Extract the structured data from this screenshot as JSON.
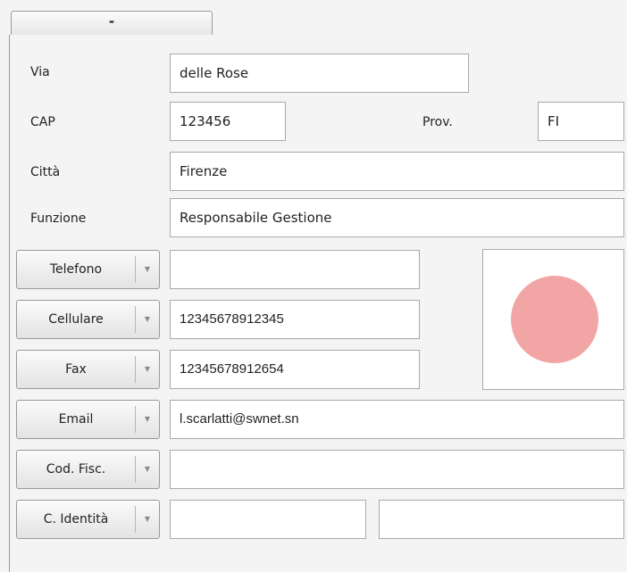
{
  "tab": {
    "label": "-"
  },
  "labels": {
    "via": "Via",
    "cap": "CAP",
    "prov": "Prov.",
    "citta": "Città",
    "funzione": "Funzione"
  },
  "fields": {
    "via": "delle Rose",
    "cap": "123456",
    "prov": "FI",
    "citta": "Firenze",
    "funzione": "Responsabile Gestione",
    "telefono": "",
    "cellulare": "12345678912345",
    "fax": "12345678912654",
    "email": "l.scarlatti@swnet.sn",
    "cod_fisc": "",
    "c_identita_1": "",
    "c_identita_2": ""
  },
  "combos": {
    "telefono": "Telefono",
    "cellulare": "Cellulare",
    "fax": "Fax",
    "email": "Email",
    "cod_fisc": "Cod. Fisc.",
    "c_identita": "C. Identità"
  },
  "icons": {
    "dropdown": "chevron-down-icon",
    "photo": "status-dot"
  },
  "colors": {
    "status_dot": "#f2a5a5"
  }
}
